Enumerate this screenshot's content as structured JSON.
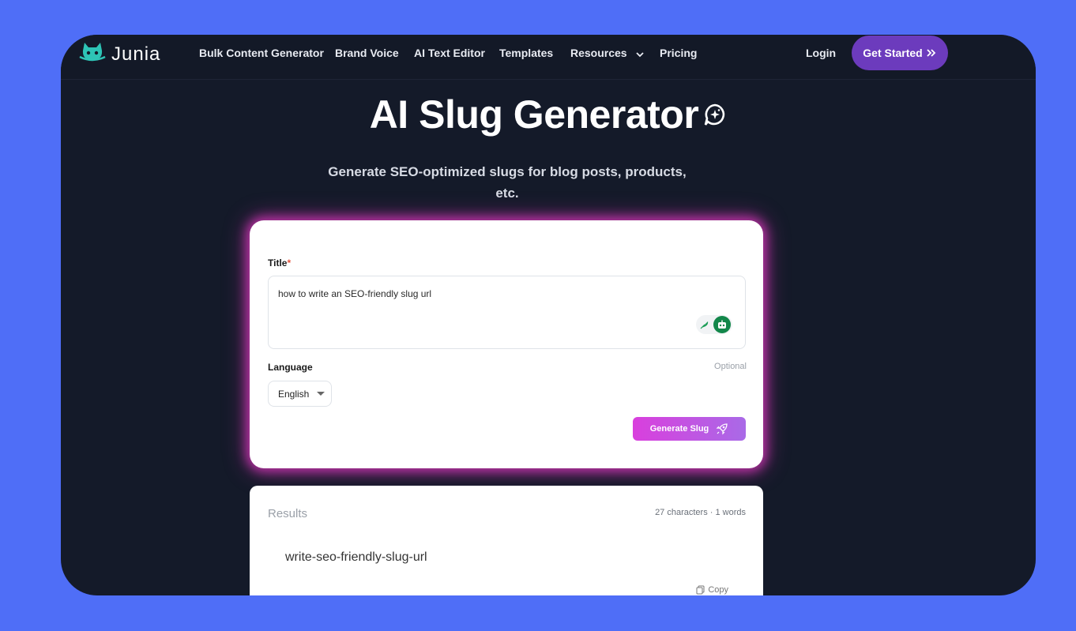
{
  "colors": {
    "page_bg": "#4f6ef7",
    "frame_bg": "#141a29",
    "accent_purple": "#6c3bbd",
    "glow": "#e438c4",
    "logo_teal": "#2ec4b6"
  },
  "brand": {
    "name": "Junia",
    "logo_icon": "cat-logo-icon"
  },
  "nav": {
    "links": [
      "Bulk Content Generator",
      "Brand Voice",
      "AI Text Editor",
      "Templates",
      "Resources",
      "Pricing"
    ],
    "login": "Login",
    "cta": "Get Started"
  },
  "hero": {
    "title": "AI Slug Generator",
    "subtitle": "Generate SEO-optimized slugs for blog posts, products, etc."
  },
  "form": {
    "title_label": "Title",
    "required_mark": "*",
    "title_value": "how to write an SEO-friendly slug url",
    "language_label": "Language",
    "optional_text": "Optional",
    "language_value": "English",
    "generate_button": "Generate Slug"
  },
  "results": {
    "title": "Results",
    "count": "27 characters · 1 words",
    "slug": "write-seo-friendly-slug-url",
    "copy_label": "Copy"
  }
}
